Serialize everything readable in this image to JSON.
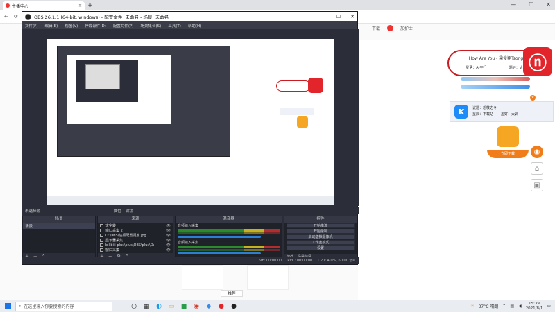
{
  "browser": {
    "tab_title": "主播中心",
    "window_controls": [
      "—",
      "☐",
      "✕"
    ],
    "nav_links": [
      "下载",
      "加护士"
    ],
    "widgets": {
      "music_title": "How Are You - 梁俊翔Tsong",
      "music_singer_label": "星语：A-平行",
      "music_period": "题好：太调",
      "k_line1": "议题：想敬之令",
      "k_line2": "星辰：下载站",
      "k_line3": "盖好：大调",
      "duck_button": "立即下载"
    }
  },
  "obs": {
    "title": "OBS 26.1.1 (64-bit, windows) - 配置文件: 未命名 - 场景: 未命名",
    "menu": [
      "文件(F)",
      "编辑(E)",
      "视图(V)",
      "停靠部件(D)",
      "配置文件(P)",
      "场景集合(S)",
      "工具(T)",
      "帮助(H)"
    ],
    "docks_header": [
      "未选择源",
      "属性",
      "滤镜"
    ],
    "scenes": {
      "header": "场景",
      "items": [
        "场景"
      ]
    },
    "sources": {
      "header": "来源",
      "items": [
        "文字转",
        "窗口采集 2",
        "D:\\OBS\\信报配置调度.jpg",
        "显示器采集",
        "bilibili-plus\\plus\\OBS\\plus\\DateDisplay",
        "窗口采集",
        "音频输出采集"
      ]
    },
    "mixer": {
      "header": "混音器",
      "channels": [
        "音频输入采集",
        "音频输入采集"
      ]
    },
    "controls": {
      "header": "控件",
      "buttons": [
        "开始推流",
        "开始录制",
        "启动虚拟摄像机",
        "工作室模式",
        "设置",
        "退出"
      ],
      "tabs": [
        "控件",
        "场景转场"
      ]
    },
    "status": [
      "LIVE: 00:00:00",
      "REC: 00:00:00",
      "CPU: 4.0%, 60.00 fps"
    ]
  },
  "tooltip": "推荐",
  "taskbar": {
    "search_placeholder": "在这里输入你要搜索的内容",
    "weather": "37°C 晴朗",
    "time": "15:39",
    "date": "2021/8/1"
  }
}
